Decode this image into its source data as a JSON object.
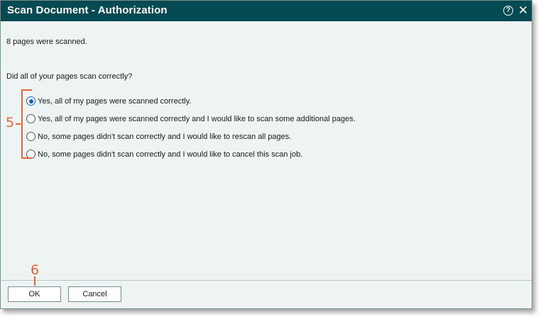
{
  "dialog": {
    "title": "Scan Document - Authorization",
    "help_glyph": "?",
    "close_glyph": "✕"
  },
  "content": {
    "message": "8 pages were scanned.",
    "question": "Did all of your pages scan correctly?",
    "options": [
      {
        "label": "Yes, all of my pages were scanned correctly.",
        "selected": true
      },
      {
        "label": "Yes, all of my pages were scanned correctly and I would like to scan some additional pages.",
        "selected": false
      },
      {
        "label": "No, some pages didn't scan correctly and I would like to rescan all pages.",
        "selected": false
      },
      {
        "label": "No, some pages didn't scan correctly and I would like to cancel this scan job.",
        "selected": false
      }
    ]
  },
  "callouts": {
    "options_number": "5",
    "ok_number": "6"
  },
  "buttons": {
    "ok_label": "OK",
    "cancel_label": "Cancel"
  },
  "colors": {
    "titlebar": "#034a52",
    "callout": "#e8643c",
    "radio_selected": "#0a5fc9"
  },
  "icons": {
    "help": "help-circle-icon",
    "close": "close-icon"
  }
}
